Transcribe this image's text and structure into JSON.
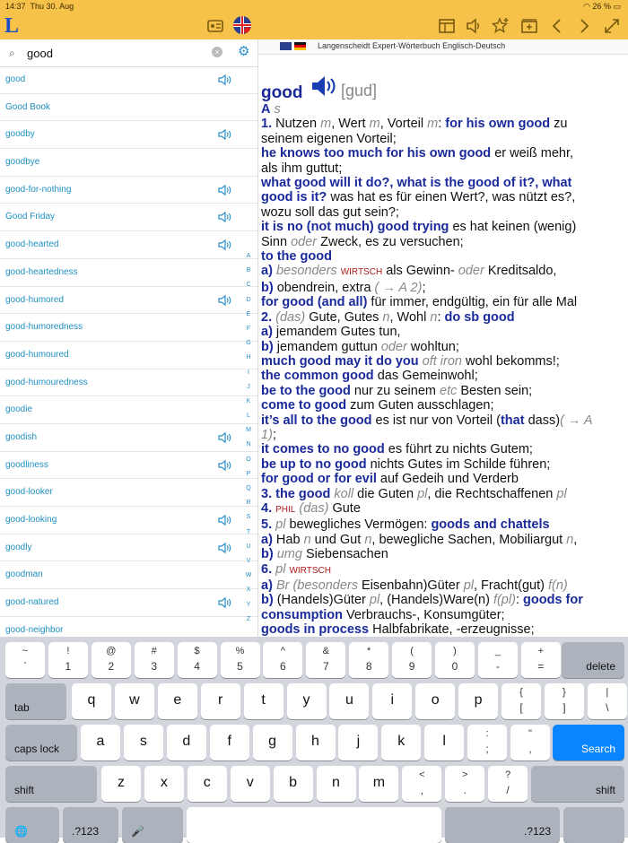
{
  "status": {
    "time": "14:37",
    "date": "Thu 30. Aug",
    "battery": "26 %"
  },
  "topbar": {
    "logo": "L"
  },
  "search": {
    "value": "good",
    "clear": "×",
    "search_glyph": "⌕",
    "gear_glyph": "⚙"
  },
  "words": [
    "good",
    "Good Book",
    "goodby",
    "goodbye",
    "good-for-nothing",
    "Good Friday",
    "good-hearted",
    "good-heartedness",
    "good-humored",
    "good-humoredness",
    "good-humoured",
    "good-humouredness",
    "goodie",
    "goodish",
    "goodliness",
    "good-looker",
    "good-looking",
    "goodly",
    "goodman",
    "good-natured",
    "good-neighbor"
  ],
  "audio": [
    true,
    false,
    true,
    false,
    true,
    true,
    true,
    false,
    true,
    false,
    false,
    false,
    false,
    true,
    true,
    false,
    true,
    true,
    false,
    true,
    false
  ],
  "alphabet": [
    "A",
    "B",
    "C",
    "D",
    "E",
    "F",
    "G",
    "H",
    "I",
    "J",
    "K",
    "L",
    "M",
    "N",
    "O",
    "P",
    "Q",
    "R",
    "S",
    "T",
    "U",
    "V",
    "W",
    "X",
    "Y",
    "Z"
  ],
  "dictionary": {
    "title": "Langenscheidt Expert-Wörterbuch Englisch-Deutsch"
  },
  "entry": {
    "headword": "good",
    "pron": "[gud]"
  },
  "keyboard": {
    "row1": [
      [
        "~",
        "`"
      ],
      [
        "!",
        "1"
      ],
      [
        "@",
        "2"
      ],
      [
        "#",
        "3"
      ],
      [
        "$",
        "4"
      ],
      [
        "%",
        "5"
      ],
      [
        "^",
        "6"
      ],
      [
        "&",
        "7"
      ],
      [
        "*",
        "8"
      ],
      [
        "(",
        "9"
      ],
      [
        ")",
        "0"
      ],
      [
        "_",
        "-"
      ],
      [
        "+",
        "="
      ]
    ],
    "row2": [
      "q",
      "w",
      "e",
      "r",
      "t",
      "y",
      "u",
      "i",
      "o",
      "p"
    ],
    "row2p": [
      [
        "{",
        "["
      ],
      [
        "}",
        "]"
      ],
      [
        "|",
        "\\"
      ]
    ],
    "row3": [
      "a",
      "s",
      "d",
      "f",
      "g",
      "h",
      "j",
      "k",
      "l"
    ],
    "row3p": [
      [
        ":",
        ";"
      ],
      [
        "\"",
        ","
      ]
    ],
    "row4": [
      "z",
      "x",
      "c",
      "v",
      "b",
      "n",
      "m"
    ],
    "row4p": [
      [
        "<",
        ","
      ],
      [
        ">",
        "."
      ],
      [
        "?",
        "/"
      ]
    ],
    "delete": "delete",
    "tab": "tab",
    "caps": "caps lock",
    "search": "Search",
    "shift": "shift",
    "num": ".?123",
    "globe": "🌐",
    "mic": "🎤"
  }
}
